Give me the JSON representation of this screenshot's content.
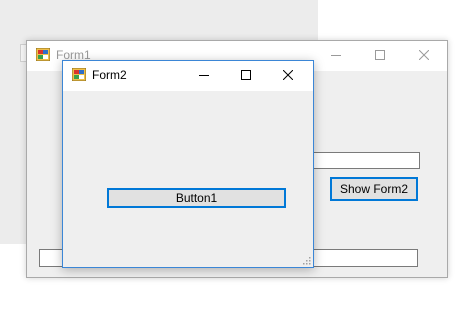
{
  "form1": {
    "title": "Form1",
    "show_form2_label": "Show Form2"
  },
  "form2": {
    "title": "Form2",
    "button1_label": "Button1"
  },
  "icons": {
    "app": "winforms-app-icon",
    "minimize": "minimize-icon",
    "maximize": "maximize-icon",
    "close": "close-icon",
    "resize": "resize-grip-icon"
  },
  "colors": {
    "active_border": "#3b86d6",
    "button_focus_border": "#0078d7",
    "window_body": "#efefef"
  }
}
